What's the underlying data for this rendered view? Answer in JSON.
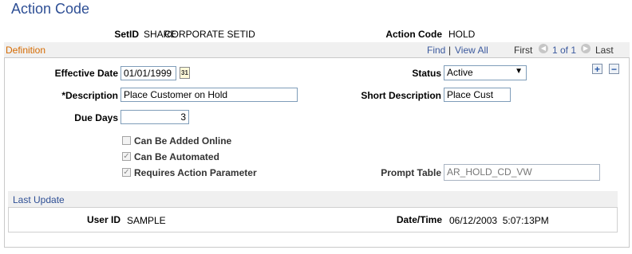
{
  "page_title": "Action Code",
  "header": {
    "setid_label": "SetID",
    "setid_value": "SHARE",
    "setid_desc": "CORPORATE SETID",
    "action_code_label": "Action Code",
    "action_code_value": "HOLD"
  },
  "definition": {
    "section_title": "Definition",
    "nav": {
      "find": "Find",
      "separator": "|",
      "view_all": "View All",
      "first": "First",
      "range": "1 of 1",
      "last": "Last"
    },
    "effective_date_label": "Effective Date",
    "effective_date_value": "01/01/1999",
    "status_label": "Status",
    "status_value": "Active",
    "description_label": "*Description",
    "description_value": "Place Customer on Hold",
    "short_description_label": "Short Description",
    "short_description_value": "Place Cust",
    "due_days_label": "Due Days",
    "due_days_value": "3",
    "checkboxes": [
      {
        "label": "Can Be Added Online",
        "checked": false
      },
      {
        "label": "Can Be Automated",
        "checked": true
      },
      {
        "label": "Requires Action Parameter",
        "checked": true
      }
    ],
    "prompt_table_label": "Prompt Table",
    "prompt_table_value": "AR_HOLD_CD_VW",
    "add_symbol": "+",
    "remove_symbol": "−",
    "calendar_glyph": "31"
  },
  "last_update": {
    "section_title": "Last Update",
    "user_id_label": "User ID",
    "user_id_value": "SAMPLE",
    "datetime_label": "Date/Time",
    "datetime_value": "06/12/2003  5:07:13PM"
  },
  "colors": {
    "title": "#2e4f95",
    "section_title": "#d56a00",
    "link": "#3c5a9e"
  },
  "icons": [
    "calendar-icon",
    "first-arrow-icon",
    "next-arrow-icon",
    "add-row-icon",
    "delete-row-icon",
    "dropdown-arrow-icon",
    "check-icon"
  ]
}
